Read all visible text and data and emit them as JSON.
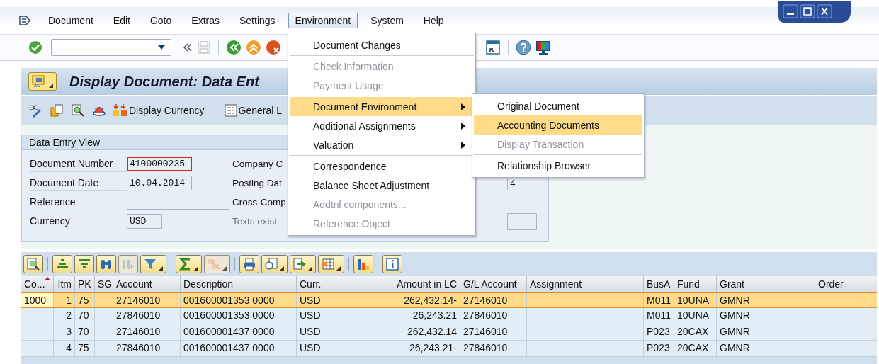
{
  "menu_bar": [
    {
      "label": "Document",
      "selected": false
    },
    {
      "label": "Edit",
      "selected": false
    },
    {
      "label": "Goto",
      "selected": false
    },
    {
      "label": "Extras",
      "selected": false
    },
    {
      "label": "Settings",
      "selected": false
    },
    {
      "label": "Environment",
      "selected": true
    },
    {
      "label": "System",
      "selected": false
    },
    {
      "label": "Help",
      "selected": false
    }
  ],
  "title": "Display Document: Data Ent",
  "app_toolbar": [
    "Display Currency",
    "General L"
  ],
  "data_entry_view": {
    "title": "Data Entry View",
    "rows": [
      {
        "label": "Document Number",
        "value": "4100000235",
        "focused": true,
        "label_2": "Company C",
        "label_2_disabled": false
      },
      {
        "label": "Document Date",
        "value": "10.04.2014",
        "focused": false,
        "label_2": "Posting Dat",
        "label_2_disabled": false,
        "extra_field": true,
        "extra_value": "4"
      },
      {
        "label": "Reference",
        "focused": false,
        "label_2": "Cross-Comp",
        "label_2_disabled": false
      },
      {
        "label": "Currency",
        "value": "USD",
        "focused": false,
        "label_2": "Texts exist",
        "label_2_disabled": true,
        "extra_field": true
      }
    ]
  },
  "table": {
    "columns": [
      {
        "label": "Co...",
        "sorted": true
      },
      {
        "label": "Itm",
        "sorted": false
      },
      {
        "label": "PK",
        "sorted": false
      },
      {
        "label": "SG",
        "sorted": false
      },
      {
        "label": "Account",
        "sorted": false
      },
      {
        "label": "Description",
        "sorted": false
      },
      {
        "label": "Curr.",
        "sorted": false
      },
      {
        "label": "Amount in LC",
        "sorted": false
      },
      {
        "label": "G/L Account",
        "sorted": false
      },
      {
        "label": "Assignment",
        "sorted": false
      },
      {
        "label": "BusA",
        "sorted": false
      },
      {
        "label": "Fund",
        "sorted": false
      },
      {
        "label": "Grant",
        "sorted": false
      },
      {
        "label": "Order",
        "sorted": false
      }
    ],
    "rows": [
      {
        "selected": true,
        "cells": [
          "1000",
          "1",
          "75",
          null,
          "27146010",
          "001600001353 0000",
          "USD",
          "262,432.14-",
          "27146010",
          null,
          "M011",
          "10UNA",
          "GMNR",
          null
        ]
      },
      {
        "selected": false,
        "cells": [
          null,
          "2",
          "70",
          null,
          "27846010",
          "001600001353 0000",
          "USD",
          "26,243.21",
          "27846010",
          null,
          "M011",
          "10UNA",
          "GMNR",
          null
        ]
      },
      {
        "selected": false,
        "cells": [
          null,
          "3",
          "70",
          null,
          "27146010",
          "001600001437 0000",
          "USD",
          "262,432.14",
          "27146010",
          null,
          "P023",
          "20CAX",
          "GMNR",
          null
        ]
      },
      {
        "selected": false,
        "cells": [
          null,
          "4",
          "75",
          null,
          "27846010",
          "001600001437 0000",
          "USD",
          "26,243.21-",
          "27846010",
          null,
          "P023",
          "20CAX",
          "GMNR",
          null
        ]
      }
    ]
  },
  "environment_menu": [
    {
      "kind": "item",
      "label": "Document Changes",
      "disabled": false,
      "selected": false,
      "submenu": false
    },
    {
      "kind": "separator"
    },
    {
      "kind": "item",
      "label": "Check Information",
      "disabled": true,
      "selected": false,
      "submenu": false
    },
    {
      "kind": "item",
      "label": "Payment Usage",
      "disabled": true,
      "selected": false,
      "submenu": false
    },
    {
      "kind": "separator"
    },
    {
      "kind": "item",
      "label": "Document Environment",
      "disabled": false,
      "selected": true,
      "submenu": true
    },
    {
      "kind": "item",
      "label": "Additional Assignments",
      "disabled": false,
      "selected": false,
      "submenu": true
    },
    {
      "kind": "item",
      "label": "Valuation",
      "disabled": false,
      "selected": false,
      "submenu": true
    },
    {
      "kind": "separator"
    },
    {
      "kind": "item",
      "label": "Correspondence",
      "disabled": false,
      "selected": false,
      "submenu": false
    },
    {
      "kind": "item",
      "label": "Balance Sheet Adjustment",
      "disabled": false,
      "selected": false,
      "submenu": false
    },
    {
      "kind": "item",
      "label": "Addtnl components...",
      "disabled": true,
      "selected": false,
      "submenu": false
    },
    {
      "kind": "item",
      "label": "Reference Object",
      "disabled": true,
      "selected": false,
      "submenu": false
    }
  ],
  "document_environment_submenu": [
    {
      "kind": "item",
      "label": "Original Document",
      "disabled": false,
      "selected": false
    },
    {
      "kind": "item",
      "label": "Accounting Documents",
      "disabled": false,
      "selected": true
    },
    {
      "kind": "item",
      "label": "Display Transaction",
      "disabled": true,
      "selected": false
    },
    {
      "kind": "separator"
    },
    {
      "kind": "item",
      "label": "Relationship Browser",
      "disabled": false,
      "selected": false
    }
  ]
}
